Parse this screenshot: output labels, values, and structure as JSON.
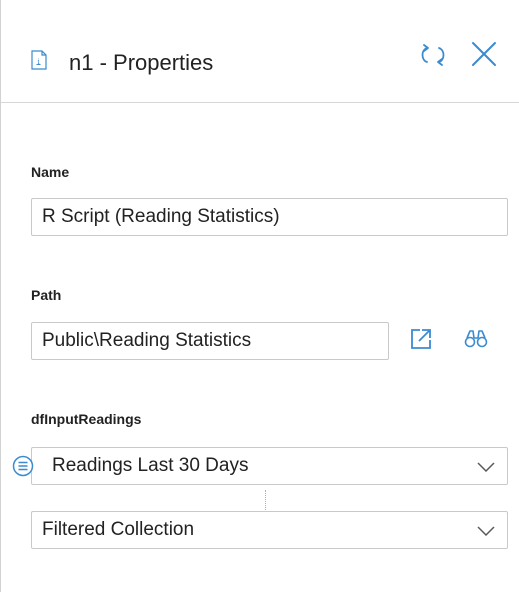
{
  "header": {
    "title": "n1 - Properties",
    "icons": {
      "document": "document-info-icon",
      "refresh": "refresh-icon",
      "close": "close-icon"
    }
  },
  "fields": {
    "name": {
      "label": "Name",
      "value": "R Script (Reading Statistics)"
    },
    "path": {
      "label": "Path",
      "value": "Public\\Reading Statistics",
      "icons": {
        "open": "open-external-icon",
        "browse": "binoculars-icon"
      }
    },
    "input": {
      "label": "dfInputReadings",
      "query": "Readings Last 30 Days",
      "collection": "Filtered Collection",
      "icons": {
        "collection": "collection-list-icon",
        "dropdown": "chevron-down-icon"
      }
    }
  },
  "colors": {
    "accent": "#3a8bd0",
    "border": "#c9c9c9",
    "divider": "#d6d6d6",
    "text": "#222222"
  }
}
